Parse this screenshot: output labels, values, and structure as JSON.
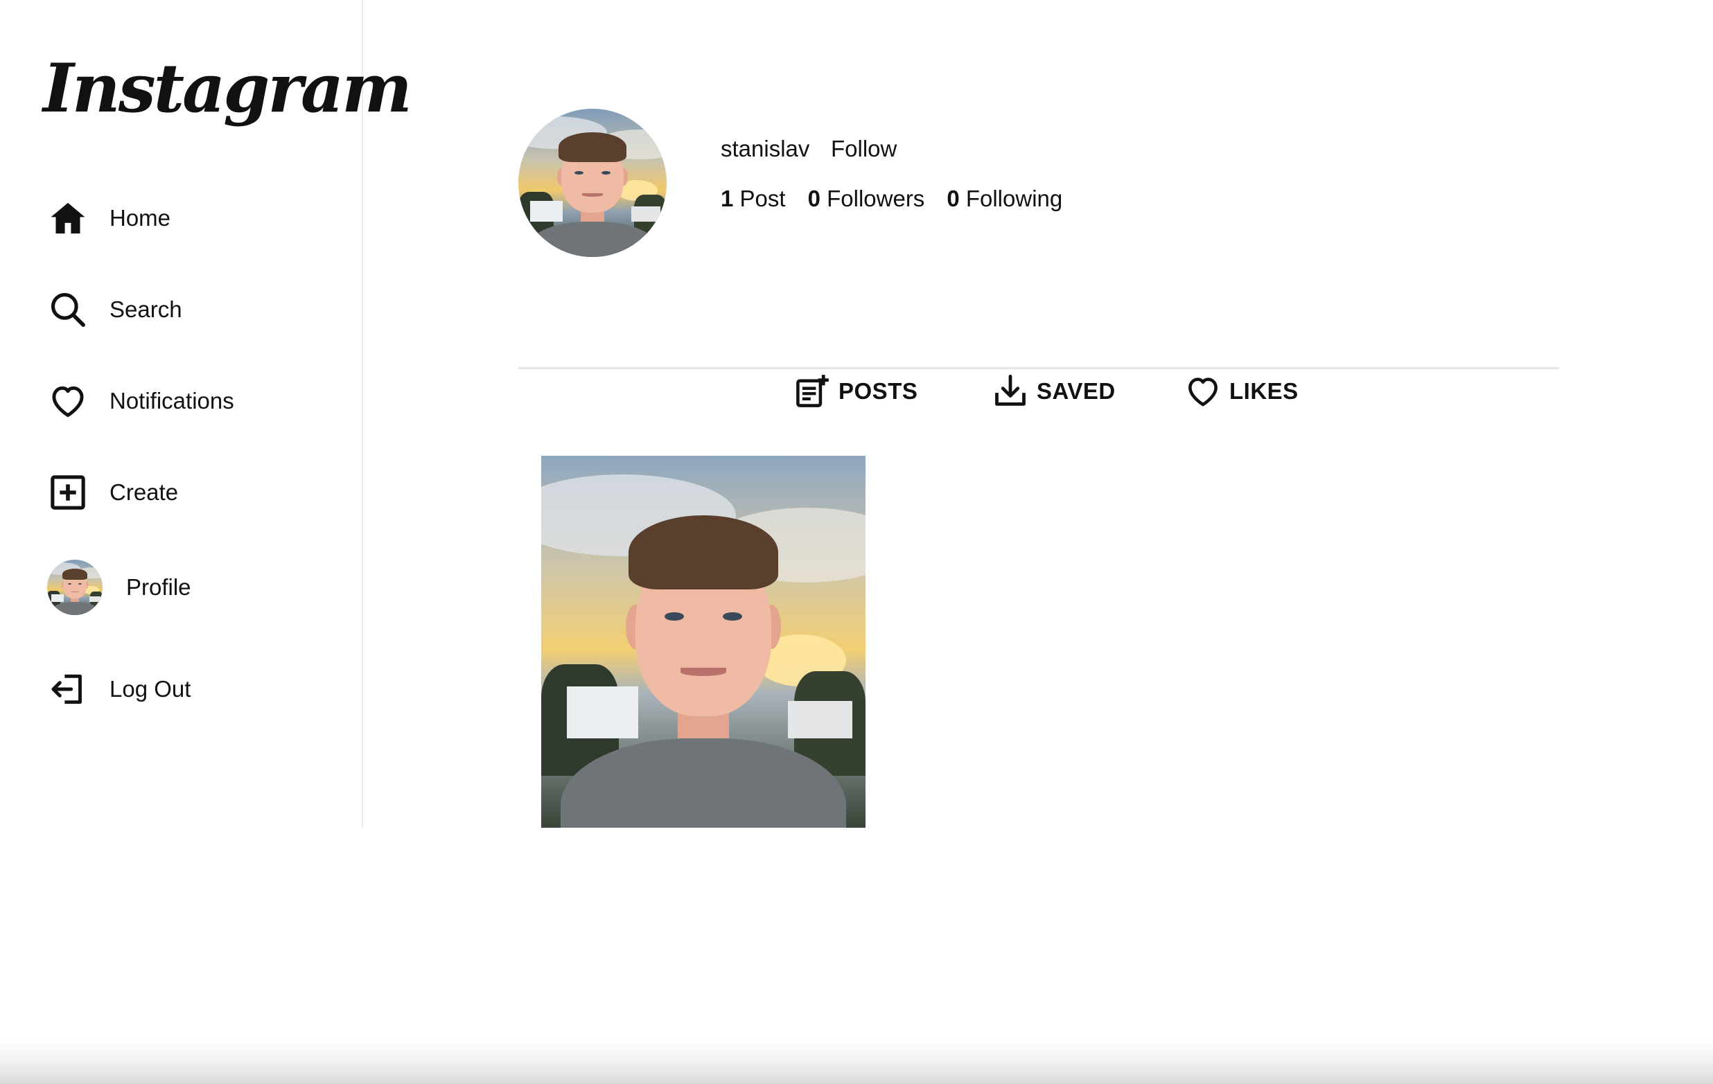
{
  "app": {
    "logo_text": "Instagram"
  },
  "sidebar": {
    "items": [
      {
        "label": "Home",
        "icon": "home-icon"
      },
      {
        "label": "Search",
        "icon": "search-icon"
      },
      {
        "label": "Notifications",
        "icon": "heart-icon"
      },
      {
        "label": "Create",
        "icon": "plus-square-icon"
      },
      {
        "label": "Profile",
        "icon": "avatar"
      },
      {
        "label": "Log Out",
        "icon": "logout-icon"
      }
    ]
  },
  "profile": {
    "username": "stanislav",
    "follow_label": "Follow",
    "stats": {
      "posts_count": "1",
      "posts_label": "Post",
      "followers_count": "0",
      "followers_label": "Followers",
      "following_count": "0",
      "following_label": "Following"
    }
  },
  "tabs": [
    {
      "label": "POSTS",
      "icon": "add-post-icon"
    },
    {
      "label": "SAVED",
      "icon": "download-icon"
    },
    {
      "label": "LIKES",
      "icon": "heart-icon"
    }
  ],
  "posts": [
    {
      "image": "portrait-photo"
    }
  ],
  "colors": {
    "text": "#111111",
    "divider": "#e3e6ea",
    "sidebar_border": "#ececec",
    "background": "#ffffff"
  }
}
